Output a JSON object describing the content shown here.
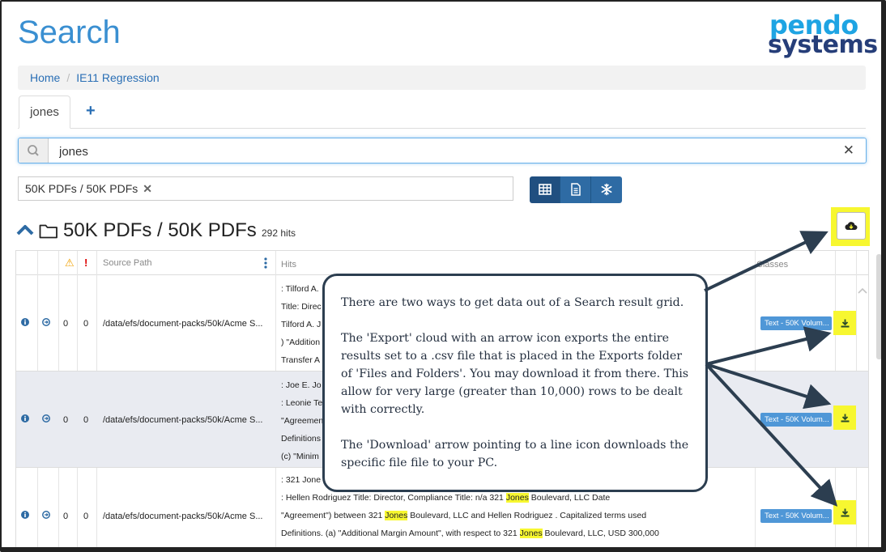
{
  "page": {
    "title": "Search",
    "logo_line1": "pendo",
    "logo_line2": "systems"
  },
  "breadcrumb": [
    {
      "label": "Home"
    },
    {
      "label": "IE11 Regression"
    }
  ],
  "tabs": [
    {
      "label": "jones"
    }
  ],
  "tab_add_label": "+",
  "search": {
    "value": "jones",
    "clear_glyph": "✕"
  },
  "filter": {
    "label": "50K PDFs / 50K PDFs",
    "remove_glyph": "✕"
  },
  "view_toggle": [
    "grid-icon",
    "document-icon",
    "snowflake-icon"
  ],
  "section": {
    "title": "50K PDFs / 50K PDFs",
    "hits": "292 hits"
  },
  "grid": {
    "headers": {
      "warning": "⚠",
      "error": "!",
      "source_path": "Source Path",
      "hits": "Hits",
      "classes": "Classes"
    },
    "rows": [
      {
        "warn": "0",
        "err": "0",
        "path": "/data/efs/document-packs/50k/Acme S...",
        "hits": [
          ": Tilford A.",
          "Title: Direc",
          "Tilford A. J",
          ") \"Addition",
          "Transfer A"
        ],
        "class": "Text - 50K Volum..."
      },
      {
        "warn": "0",
        "err": "0",
        "path": "/data/efs/document-packs/50k/Acme S...",
        "hits": [
          ": Joe E. Jo",
          ": Leonie Te",
          "\"Agreemen",
          "Definitions",
          "(c) \"Minim"
        ],
        "class": "Text - 50K Volum..."
      },
      {
        "warn": "0",
        "err": "0",
        "path": "/data/efs/document-packs/50k/Acme S...",
        "hits": [
          ": 321 Jone",
          ": Hellen Rodriguez Title: Director, Compliance Title: n/a 321 Jones Boulevard, LLC Date",
          "\"Agreement\") between 321 Jones Boulevard, LLC and Hellen Rodriguez . Capitalized terms used",
          "Definitions. (a) \"Additional Margin Amount\", with respect to 321 Jones Boulevard, LLC, USD 300,000"
        ],
        "class": "Text - 50K Volum..."
      }
    ]
  },
  "callout": {
    "p1": "There are two ways to get data out of a Search result grid.",
    "p2": "The 'Export' cloud with an arrow icon exports the entire results set to a .csv file that is placed in the Exports folder of 'Files and Folders'.  You may download it from there.  This allow for very large (greater than 10,000) rows to be dealt with correctly.",
    "p3": "The 'Download' arrow pointing to a line icon downloads the specific file file to your PC."
  },
  "colors": {
    "accent": "#3a8fd1",
    "highlight": "#f7f730",
    "button_dark": "#2e6ba4",
    "badge": "#4f97d7",
    "callout_border": "#2c3e50"
  }
}
